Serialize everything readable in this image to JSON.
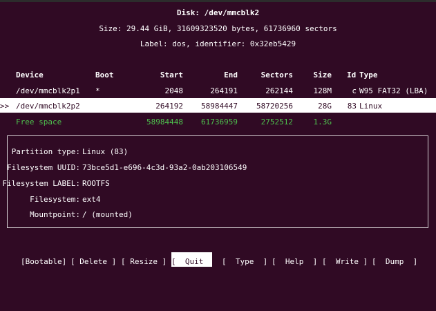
{
  "header": {
    "disk_title": "Disk: /dev/mmcblk2",
    "size_line": "Size: 29.44 GiB, 31609323520 bytes, 61736960 sectors",
    "label_line": "Label: dos, identifier: 0x32eb5429"
  },
  "table": {
    "columns": {
      "device": "Device",
      "boot": "Boot",
      "start": "Start",
      "end": "End",
      "sectors": "Sectors",
      "size": "Size",
      "id": "Id",
      "type": "Type"
    },
    "rows": [
      {
        "marker": "",
        "device": "/dev/mmcblk2p1",
        "boot": "*",
        "start": "2048",
        "end": "264191",
        "sectors": "262144",
        "size": "128M",
        "id": "c",
        "type": "W95 FAT32 (LBA)"
      },
      {
        "marker": ">>",
        "device": "/dev/mmcblk2p2",
        "boot": "",
        "start": "264192",
        "end": "58984447",
        "sectors": "58720256",
        "size": "28G",
        "id": "83",
        "type": "Linux"
      }
    ],
    "free_space": {
      "device": "Free space",
      "start": "58984448",
      "end": "61736959",
      "sectors": "2752512",
      "size": "1.3G"
    }
  },
  "info": {
    "partition_type_label": "Partition type:",
    "partition_type_value": "Linux (83)",
    "fs_uuid_label": "Filesystem UUID:",
    "fs_uuid_value": "73bce5d1-e696-4c3d-93a2-0ab203106549",
    "fs_label_label": "Filesystem LABEL:",
    "fs_label_value": "ROOTFS",
    "fs_label2": "Filesystem:",
    "fs_value": "ext4",
    "mountpoint_label": "Mountpoint:",
    "mountpoint_value": "/ (mounted)"
  },
  "menu": {
    "bootable": "[Bootable]",
    "delete": "[ Delete ]",
    "resize": "[ Resize ]",
    "quit": "[  Quit  ]",
    "type": "[  Type  ]",
    "help": "[  Help  ]",
    "write": "[  Write ]",
    "dump": "[  Dump  ]"
  },
  "colors": {
    "background": "#300a24",
    "free_space": "#4ec24e",
    "selection": "#ffffff"
  }
}
